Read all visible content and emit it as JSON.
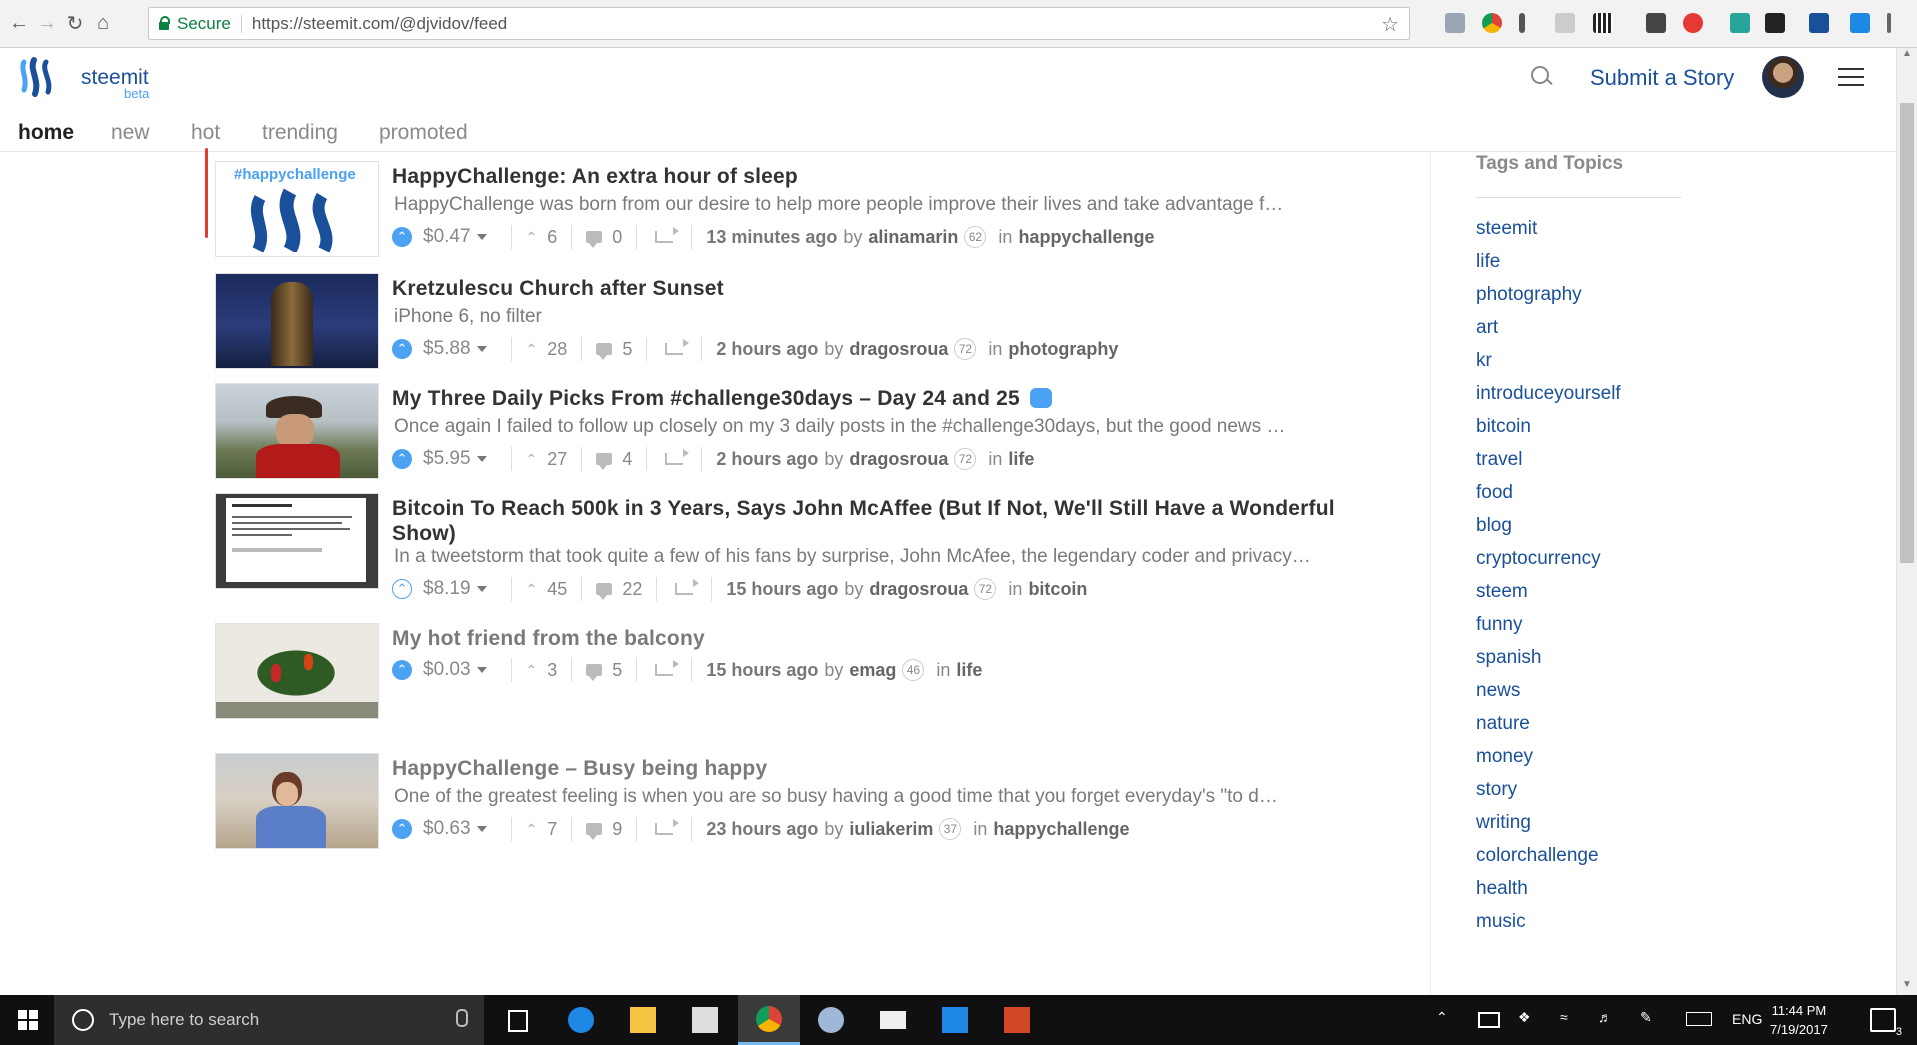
{
  "browser": {
    "secure_label": "Secure",
    "url": "https://steemit.com/@djvidov/feed"
  },
  "header": {
    "brand": "steemit",
    "beta": "beta",
    "submit_label": "Submit a Story"
  },
  "tabs": [
    "home",
    "new",
    "hot",
    "trending",
    "promoted"
  ],
  "posts": [
    {
      "title": "HappyChallenge: An extra hour of sleep",
      "summary": "HappyChallenge was born from our desire to help more people improve their lives and take advantage f…",
      "payout": "$0.47",
      "votes": "6",
      "comments": "0",
      "time": "13 minutes ago",
      "by": "by",
      "author": "alinamarin",
      "rep": "62",
      "in": "in",
      "category": "happychallenge",
      "thumb_text": "#happychallenge"
    },
    {
      "title": "Kretzulescu Church after Sunset",
      "summary": "iPhone 6, no filter",
      "payout": "$5.88",
      "votes": "28",
      "comments": "5",
      "time": "2 hours ago",
      "by": "by",
      "author": "dragosroua",
      "rep": "72",
      "in": "in",
      "category": "photography"
    },
    {
      "title": "My Three Daily Picks From #challenge30days – Day 24 and 25",
      "summary": "Once again I failed to follow up closely on my 3 daily posts in the #challenge30days, but the good news …",
      "payout": "$5.95",
      "votes": "27",
      "comments": "4",
      "time": "2 hours ago",
      "by": "by",
      "author": "dragosroua",
      "rep": "72",
      "in": "in",
      "category": "life"
    },
    {
      "title": "Bitcoin To Reach 500k in 3 Years, Says John McAffee (But If Not, We'll Still Have a Wonderful Show)",
      "summary": "In a tweetstorm that took quite a few of his fans by surprise, John McAfee, the legendary coder and privacy…",
      "payout": "$8.19",
      "votes": "45",
      "comments": "22",
      "time": "15 hours ago",
      "by": "by",
      "author": "dragosroua",
      "rep": "72",
      "in": "in",
      "category": "bitcoin"
    },
    {
      "title": "My hot friend from the balcony",
      "summary": "",
      "payout": "$0.03",
      "votes": "3",
      "comments": "5",
      "time": "15 hours ago",
      "by": "by",
      "author": "emag",
      "rep": "46",
      "in": "in",
      "category": "life"
    },
    {
      "title": "HappyChallenge – Busy being happy",
      "summary": "One of the greatest feeling is when you are so busy having a good time that you forget everyday's \"to d…",
      "payout": "$0.63",
      "votes": "7",
      "comments": "9",
      "time": "23 hours ago",
      "by": "by",
      "author": "iuliakerim",
      "rep": "37",
      "in": "in",
      "category": "happychallenge"
    }
  ],
  "sidebar": {
    "title": "Tags and Topics",
    "tags": [
      "steemit",
      "life",
      "photography",
      "art",
      "kr",
      "introduceyourself",
      "bitcoin",
      "travel",
      "food",
      "blog",
      "cryptocurrency",
      "steem",
      "funny",
      "spanish",
      "news",
      "nature",
      "money",
      "story",
      "writing",
      "colorchallenge",
      "health",
      "music"
    ]
  },
  "taskbar": {
    "search_placeholder": "Type here to search",
    "language": "ENG",
    "time": "11:44 PM",
    "date": "7/19/2017",
    "notifications": "3"
  },
  "colors": {
    "brand": "#1a5099",
    "accent": "#4ba2f2"
  }
}
